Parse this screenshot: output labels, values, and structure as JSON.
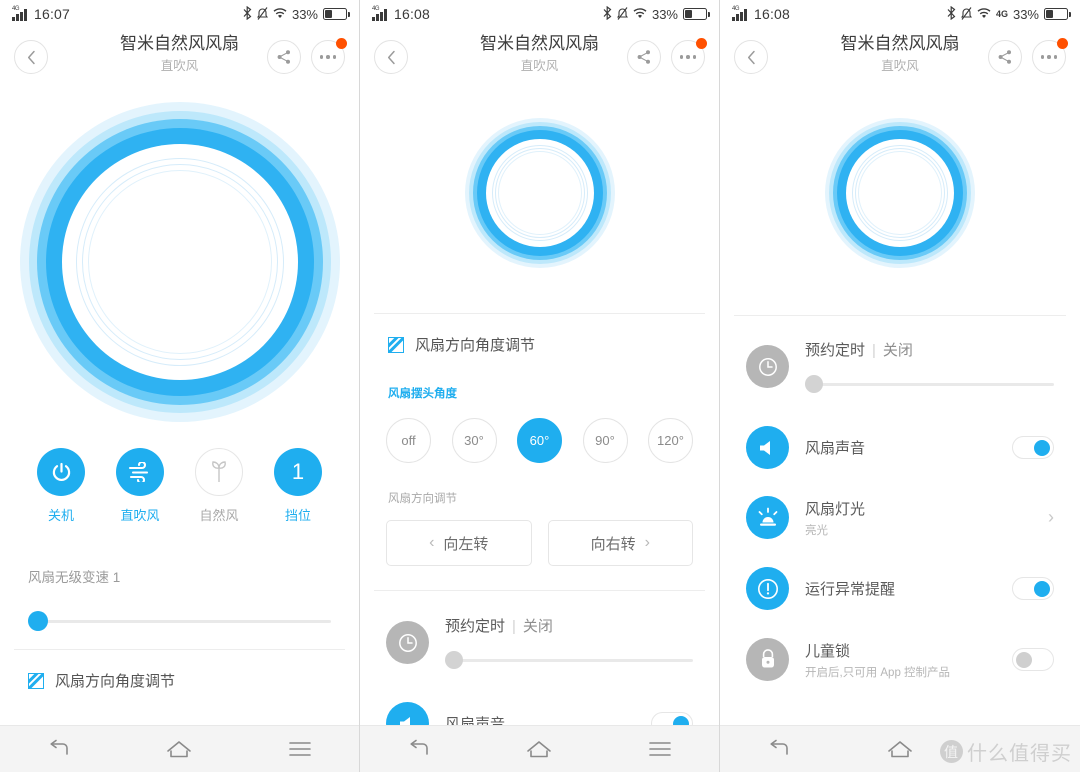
{
  "screens": [
    {
      "status": {
        "time": "16:07",
        "network": "",
        "battery_pct": "33%",
        "icons": [
          "bluetooth-icon",
          "mute-icon",
          "wifi-icon"
        ]
      },
      "header": {
        "title": "智米自然风风扇",
        "subtitle": "直吹风",
        "back": "‹",
        "share": "share-icon",
        "more": "more-icon"
      }
    },
    {
      "status": {
        "time": "16:08",
        "network": "",
        "battery_pct": "33%",
        "icons": [
          "bluetooth-icon",
          "mute-icon",
          "wifi-icon"
        ]
      },
      "header": {
        "title": "智米自然风风扇",
        "subtitle": "直吹风",
        "back": "‹",
        "share": "share-icon",
        "more": "more-icon"
      }
    },
    {
      "status": {
        "time": "16:08",
        "network": "4G",
        "battery_pct": "33%",
        "icons": [
          "bluetooth-icon",
          "mute-icon",
          "wifi-icon"
        ]
      },
      "header": {
        "title": "智米自然风风扇",
        "subtitle": "直吹风",
        "back": "‹",
        "share": "share-icon",
        "more": "more-icon"
      }
    }
  ],
  "modes": [
    {
      "label": "关机",
      "icon": "power-icon",
      "active": true
    },
    {
      "label": "直吹风",
      "icon": "wind-icon",
      "active": true
    },
    {
      "label": "自然风",
      "icon": "leaf-icon",
      "active": false
    },
    {
      "label": "挡位",
      "icon": "level-number",
      "value": "1",
      "active": true
    }
  ],
  "speed": {
    "label": "风扇无级变速 1",
    "value": 1,
    "min": 1,
    "max": 100
  },
  "angle_section": {
    "title": "风扇方向角度调节",
    "icon": "hatch-icon",
    "swing_label": "风扇摆头角度",
    "options": [
      {
        "label": "off",
        "selected": false
      },
      {
        "label": "30°",
        "selected": false
      },
      {
        "label": "60°",
        "selected": true
      },
      {
        "label": "90°",
        "selected": false
      },
      {
        "label": "120°",
        "selected": false
      }
    ],
    "direction_label": "风扇方向调节",
    "rotate_left": {
      "label": "向左转",
      "chevron": "‹"
    },
    "rotate_right": {
      "label": "向右转",
      "chevron": "›"
    }
  },
  "settings": [
    {
      "name": "timer",
      "icon": "clock-icon",
      "icon_style": "grey",
      "title": "预约定时",
      "separator": "|",
      "value": "关闭",
      "control": "slider",
      "slider_value": 0
    },
    {
      "name": "fan-sound",
      "icon": "speaker-icon",
      "icon_style": "blue",
      "title": "风扇声音",
      "control": "toggle",
      "toggle_on": true
    },
    {
      "name": "fan-light",
      "icon": "light-icon",
      "icon_style": "blue",
      "title": "风扇灯光",
      "subtitle": "亮光",
      "control": "arrow",
      "arrow": "›"
    },
    {
      "name": "anomaly-alert",
      "icon": "alert-icon",
      "icon_style": "blue",
      "title": "运行异常提醒",
      "control": "toggle",
      "toggle_on": true
    },
    {
      "name": "child-lock",
      "icon": "lock-icon",
      "icon_style": "grey",
      "title": "儿童锁",
      "subtitle": "开启后,只可用 App 控制产品",
      "control": "toggle",
      "toggle_on": false
    }
  ],
  "navbar": {
    "back": "nav-back-icon",
    "home": "nav-home-icon",
    "menu": "nav-menu-icon"
  },
  "watermark": {
    "badge": "值",
    "text": "什么值得买"
  },
  "colors": {
    "accent": "#1FAEEF",
    "badge": "#ff5000",
    "text_primary": "#5a5a5a",
    "text_muted": "#b0b0b0",
    "navbar_bg": "#f4f4f4"
  }
}
